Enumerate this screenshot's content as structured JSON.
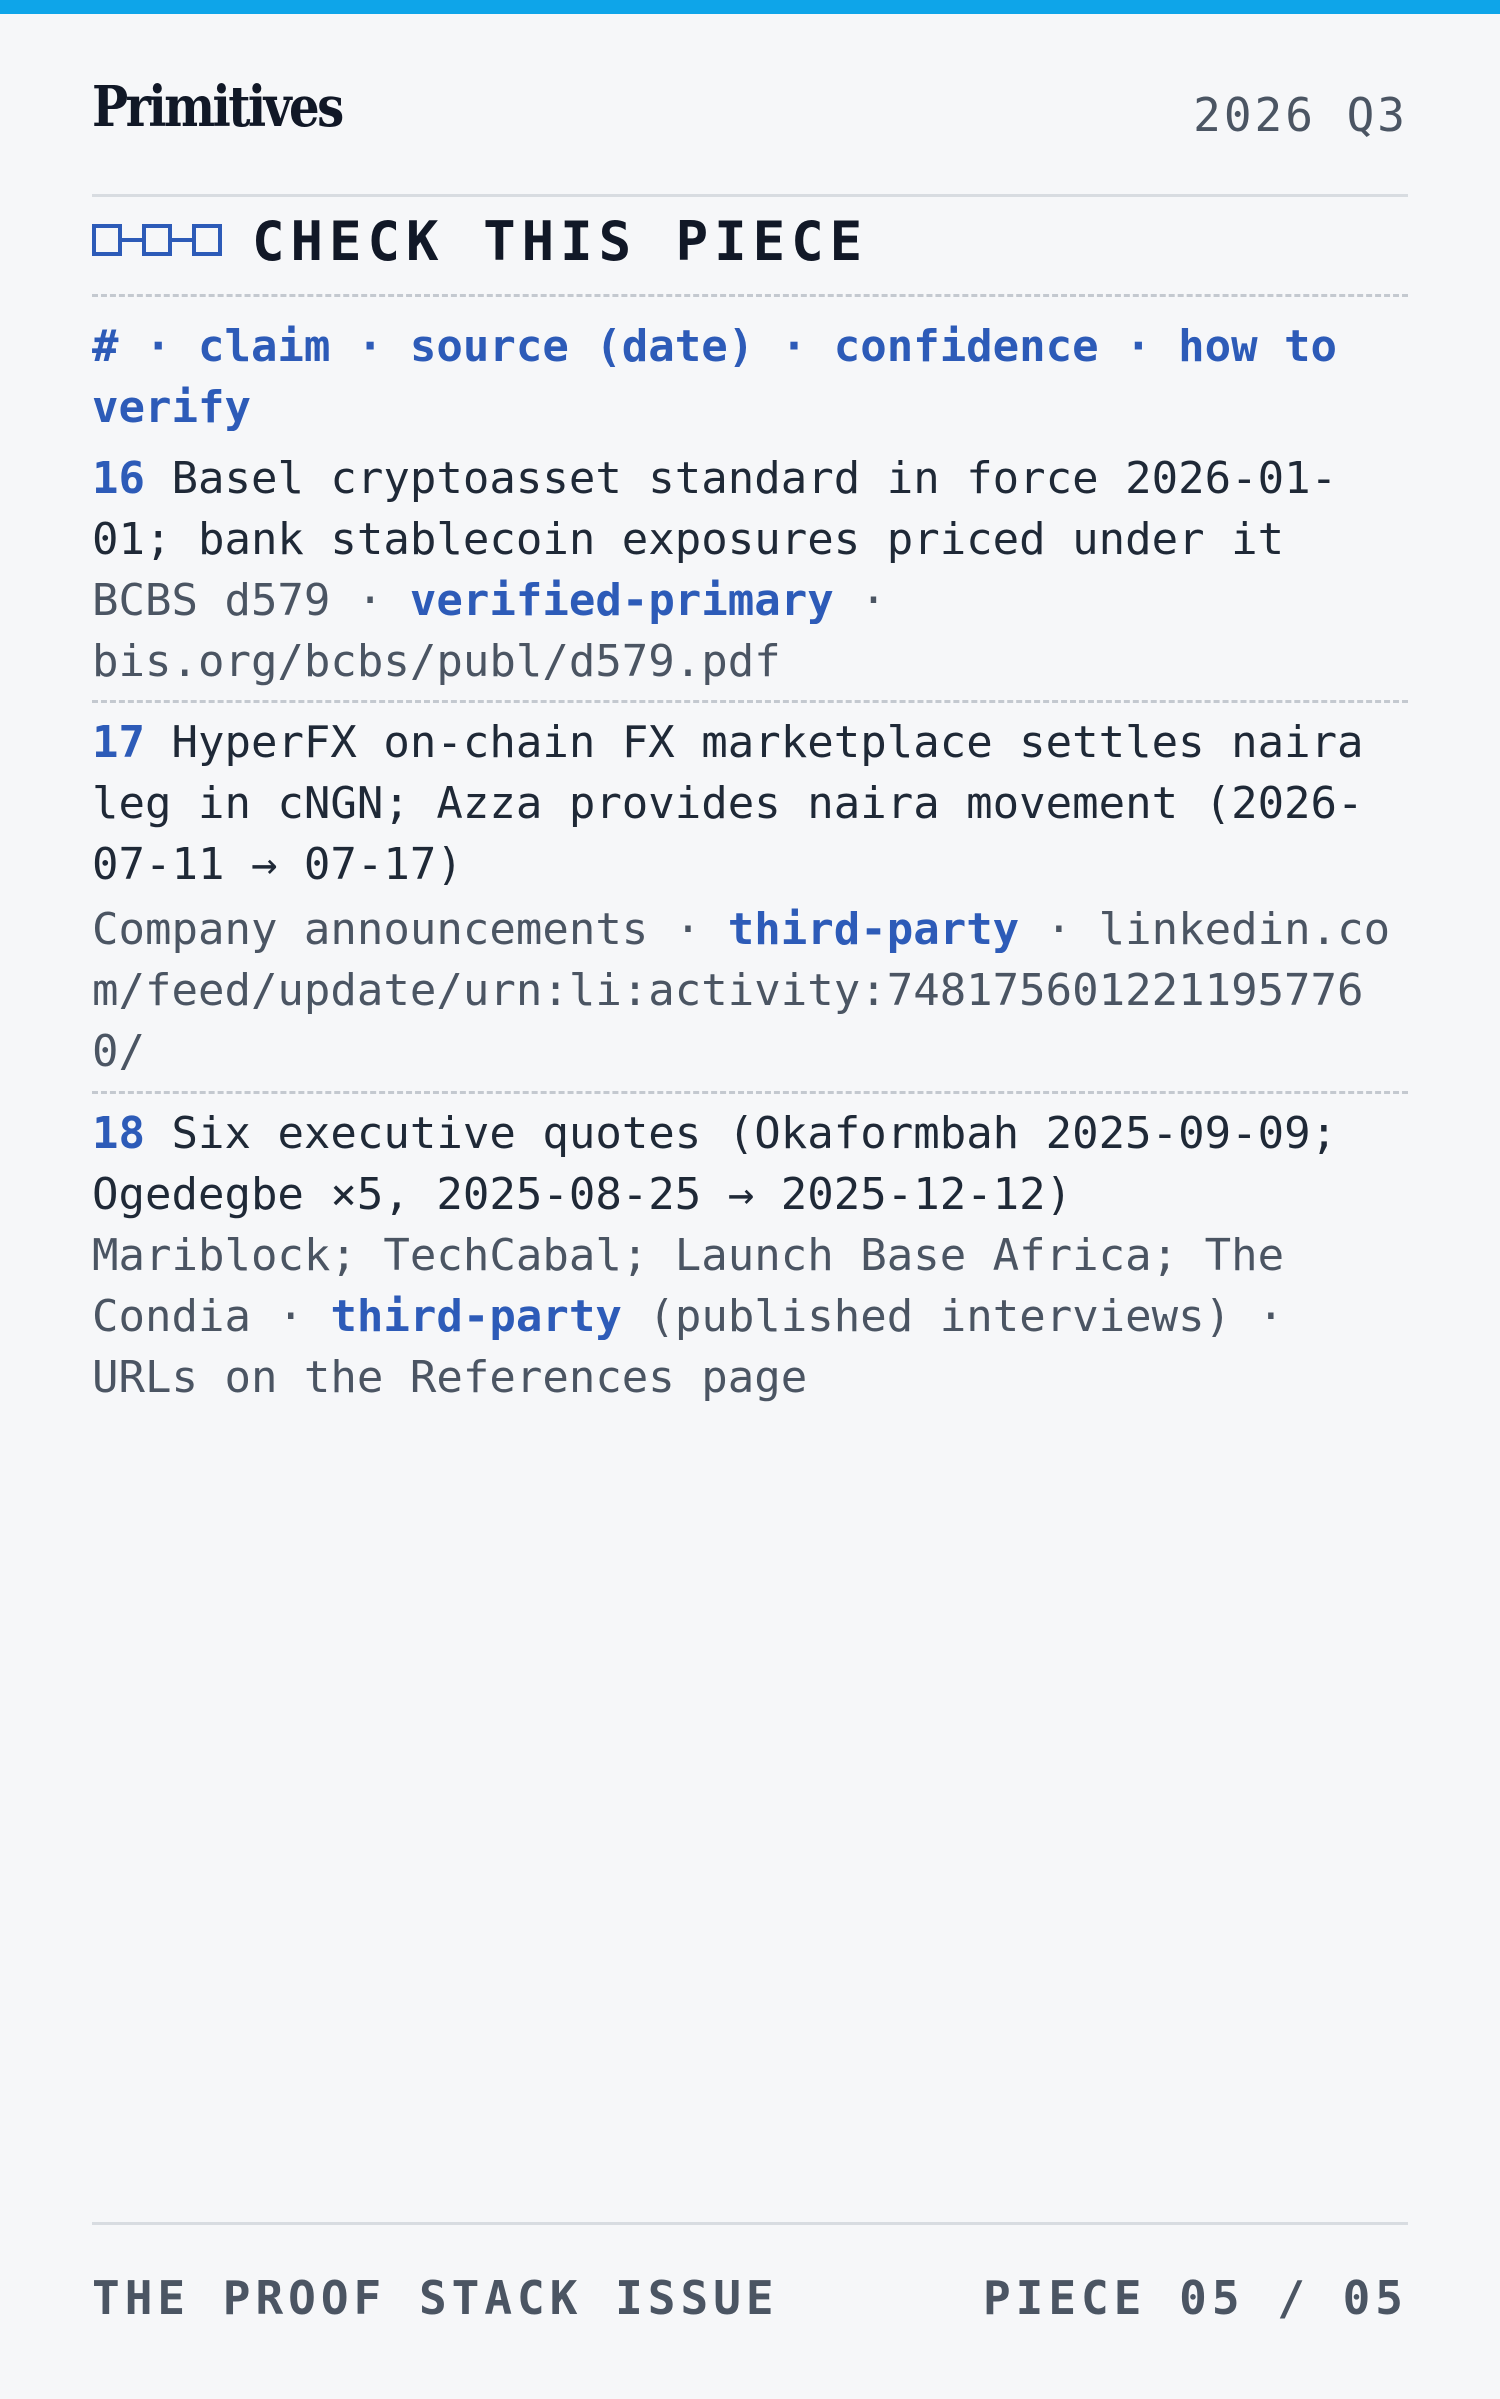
{
  "header": {
    "brand": "Primitives",
    "date": "2026 Q3"
  },
  "section": {
    "title": "CHECK THIS PIECE",
    "icon": "chain-links-icon"
  },
  "legend": {
    "text": "# · claim · source (date) · confidence · how to verify"
  },
  "entries": [
    {
      "number": "16",
      "claim": "Basel cryptoasset standard in force 2026-01-01; bank stablecoin exposures priced under it",
      "source": "BCBS d579",
      "confidence": "verified-primary",
      "verify": "bis.org/bcbs/publ/d579.pdf"
    },
    {
      "number": "17",
      "claim": "HyperFX on-chain FX marketplace settles naira leg in cNGN; Azza provides naira movement (2026-07-11 → 07-17)",
      "source": "Company announcements",
      "confidence": "third-party",
      "verify": "linkedin.com/feed/update/urn:li:activity:7481756012211957760/"
    },
    {
      "number": "18",
      "claim": "Six executive quotes (Okaformbah 2025-09-09; Ogedegbe ×5, 2025-08-25 → 2025-12-12)",
      "source": "Mariblock; TechCabal; Launch Base Africa; The Condia",
      "confidence": "third-party",
      "confidence_note": "(published interviews)",
      "verify": "URLs on the References page"
    }
  ],
  "separators": {
    "dot": " · "
  },
  "footer": {
    "issue": "THE PROOF STACK ISSUE",
    "piece": "PIECE 05 / 05"
  },
  "colors": {
    "accent_bar": "#0ea5e9",
    "link_blue": "#2d5bb8",
    "text": "#1f2937",
    "muted": "#4b5563"
  }
}
